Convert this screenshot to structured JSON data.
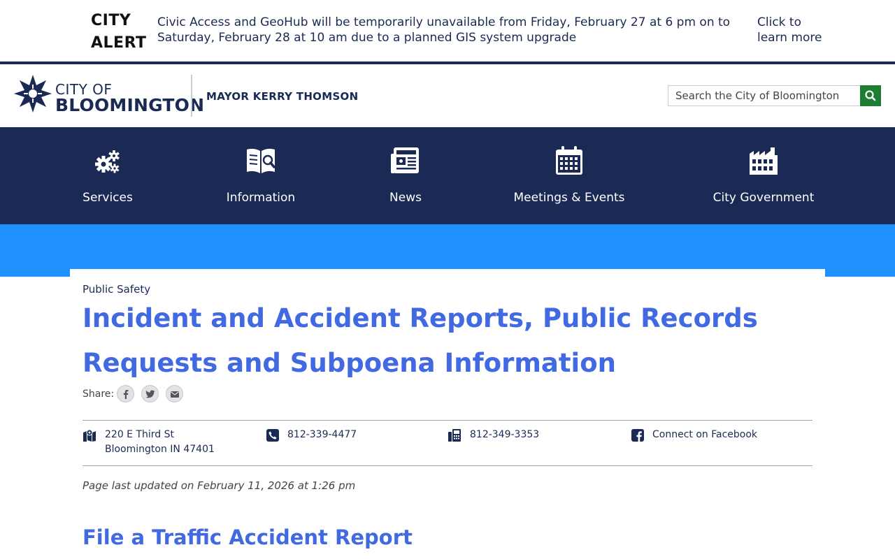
{
  "alert": {
    "title": "CITY ALERT",
    "message": "Civic Access and GeoHub will be temporarily unavailable from Friday, February 27 at 6 pm on to Saturday, February 28 at 10 am due to a planned GIS system upgrade",
    "link_label": "Click to learn more"
  },
  "header": {
    "logo_line1": "CITY OF",
    "logo_line2": "BLOOMINGTON",
    "mayor": "MAYOR KERRY THOMSON",
    "search_placeholder": "Search the City of Bloomington"
  },
  "nav": {
    "items": [
      {
        "label": "Services",
        "icon": "gears-icon"
      },
      {
        "label": "Information",
        "icon": "book-search-icon"
      },
      {
        "label": "News",
        "icon": "newspaper-icon"
      },
      {
        "label": "Meetings & Events",
        "icon": "calendar-icon"
      },
      {
        "label": "City Government",
        "icon": "building-icon"
      }
    ]
  },
  "content": {
    "breadcrumb": "Public Safety",
    "title": "Incident and Accident Reports, Public Records Requests and Subpoena Information",
    "share_label": "Share:",
    "share_buttons": [
      "facebook-icon",
      "twitter-icon",
      "email-icon"
    ],
    "contact": {
      "address_line1": "220 E Third St",
      "address_line2": "Bloomington IN 47401",
      "phone": "812-339-4477",
      "fax": "812-349-3353",
      "facebook": "Connect on Facebook"
    },
    "updated": "Page last updated on February 11, 2026 at 1:26 pm",
    "section_heading": "File a Traffic Accident Report"
  },
  "colors": {
    "navy": "#1b2a55",
    "band_blue": "#1e90ff",
    "title_blue": "#4169e1",
    "search_green": "#1c7d33"
  }
}
